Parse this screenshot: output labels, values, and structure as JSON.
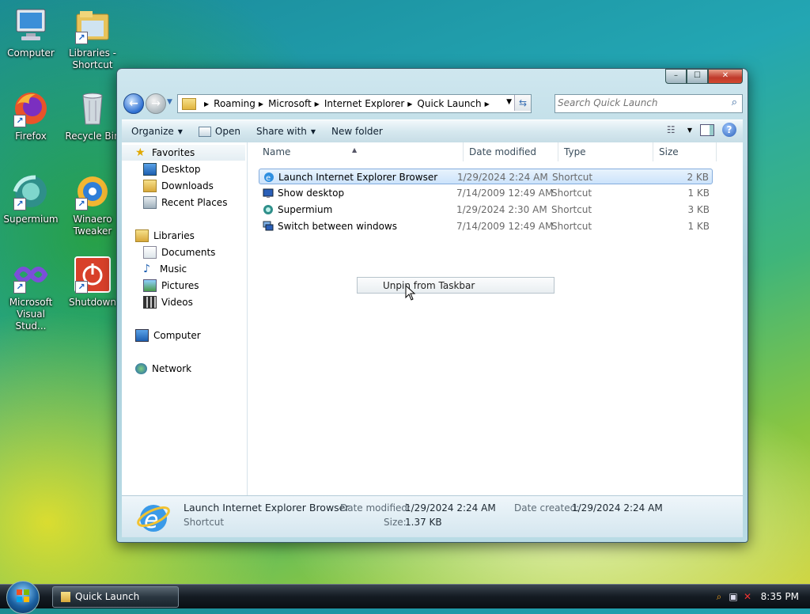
{
  "desktop": {
    "icons": [
      {
        "label": "Computer"
      },
      {
        "label": "Libraries - Shortcut"
      },
      {
        "label": "Firefox"
      },
      {
        "label": "Recycle Bin"
      },
      {
        "label": "Supermium"
      },
      {
        "label": "Winaero Tweaker"
      },
      {
        "label": "Microsoft Visual Stud..."
      },
      {
        "label": "Shutdown"
      }
    ]
  },
  "window": {
    "title_buttons": {
      "minimize": "–",
      "maximize": "☐",
      "close": "✕"
    },
    "breadcrumb": [
      "Roaming",
      "Microsoft",
      "Internet Explorer",
      "Quick Launch"
    ],
    "search_placeholder": "Search Quick Launch",
    "toolbar": {
      "organize": "Organize",
      "open": "Open",
      "share_with": "Share with",
      "new_folder": "New folder"
    },
    "nav": {
      "favorites": "Favorites",
      "favorites_items": [
        "Desktop",
        "Downloads",
        "Recent Places"
      ],
      "libraries": "Libraries",
      "libraries_items": [
        "Documents",
        "Music",
        "Pictures",
        "Videos"
      ],
      "computer": "Computer",
      "network": "Network"
    },
    "columns": {
      "name": "Name",
      "date_modified": "Date modified",
      "type": "Type",
      "size": "Size"
    },
    "files": [
      {
        "name": "Launch Internet Explorer Browser",
        "date": "1/29/2024 2:24 AM",
        "type": "Shortcut",
        "size": "2 KB",
        "icon": "ie-icon"
      },
      {
        "name": "Show desktop",
        "date": "7/14/2009 12:49 AM",
        "type": "Shortcut",
        "size": "1 KB",
        "icon": "show-desktop-icon"
      },
      {
        "name": "Supermium",
        "date": "1/29/2024 2:30 AM",
        "type": "Shortcut",
        "size": "3 KB",
        "icon": "supermium-icon"
      },
      {
        "name": "Switch between windows",
        "date": "7/14/2009 12:49 AM",
        "type": "Shortcut",
        "size": "1 KB",
        "icon": "switch-windows-icon"
      }
    ],
    "drag_tooltip": "Unpin from Taskbar",
    "details": {
      "name": "Launch Internet Explorer Browser",
      "type": "Shortcut",
      "date_modified_label": "Date modified:",
      "date_modified": "1/29/2024 2:24 AM",
      "date_created_label": "Date created:",
      "date_created": "1/29/2024 2:24 AM",
      "size_label": "Size:",
      "size": "1.37 KB"
    }
  },
  "taskbar": {
    "task_button": "Quick Launch",
    "clock": "8:35 PM"
  },
  "colors": {
    "selection": "#cce3fb",
    "accent": "#2d6fd1"
  }
}
